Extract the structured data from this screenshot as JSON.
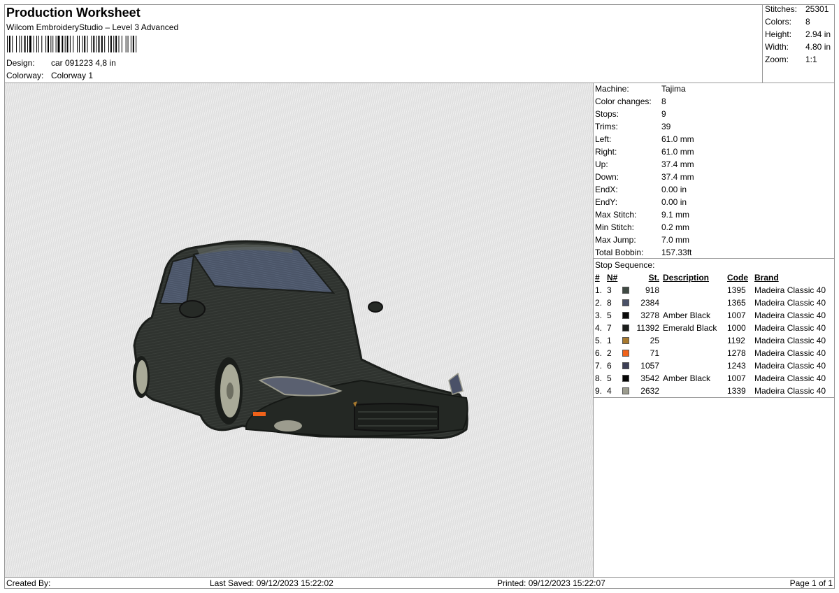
{
  "header": {
    "title": "Production Worksheet",
    "subtitle": "Wilcom EmbroideryStudio – Level 3 Advanced",
    "design_label": "Design:",
    "design_value": "car 091223 4,8 in",
    "colorway_label": "Colorway:",
    "colorway_value": "Colorway 1"
  },
  "summary": [
    {
      "label": "Stitches:",
      "value": "25301"
    },
    {
      "label": "Colors:",
      "value": "8"
    },
    {
      "label": "Height:",
      "value": "2.94 in"
    },
    {
      "label": "Width:",
      "value": "4.80 in"
    },
    {
      "label": "Zoom:",
      "value": "1:1"
    }
  ],
  "machine_info": [
    {
      "label": "Machine:",
      "value": "Tajima"
    },
    {
      "label": "Color changes:",
      "value": "8"
    },
    {
      "label": "Stops:",
      "value": "9"
    },
    {
      "label": "Trims:",
      "value": "39"
    },
    {
      "label": "Left:",
      "value": "61.0 mm"
    },
    {
      "label": "Right:",
      "value": "61.0 mm"
    },
    {
      "label": "Up:",
      "value": "37.4 mm"
    },
    {
      "label": "Down:",
      "value": "37.4 mm"
    },
    {
      "label": "EndX:",
      "value": "0.00 in"
    },
    {
      "label": "EndY:",
      "value": "0.00 in"
    },
    {
      "label": "Max Stitch:",
      "value": "9.1 mm"
    },
    {
      "label": "Min Stitch:",
      "value": "0.2 mm"
    },
    {
      "label": "Max Jump:",
      "value": "7.0 mm"
    },
    {
      "label": "Total Bobbin:",
      "value": "157.33ft"
    }
  ],
  "stop_sequence": {
    "title": "Stop Sequence:",
    "headers": {
      "idx": "#",
      "needle": "N#",
      "stitches": "St.",
      "description": "Description",
      "code": "Code",
      "brand": "Brand"
    },
    "rows": [
      {
        "idx": "1.",
        "needle": "3",
        "color": "#3f4a43",
        "stitches": "918",
        "description": "",
        "code": "1395",
        "brand": "Madeira Classic 40"
      },
      {
        "idx": "2.",
        "needle": "8",
        "color": "#4a5168",
        "stitches": "2384",
        "description": "",
        "code": "1365",
        "brand": "Madeira Classic 40"
      },
      {
        "idx": "3.",
        "needle": "5",
        "color": "#0a0a0a",
        "stitches": "3278",
        "description": "Amber Black",
        "code": "1007",
        "brand": "Madeira Classic 40"
      },
      {
        "idx": "4.",
        "needle": "7",
        "color": "#1a1d1b",
        "stitches": "11392",
        "description": "Emerald Black",
        "code": "1000",
        "brand": "Madeira Classic 40"
      },
      {
        "idx": "5.",
        "needle": "1",
        "color": "#a8792e",
        "stitches": "25",
        "description": "",
        "code": "1192",
        "brand": "Madeira Classic 40"
      },
      {
        "idx": "6.",
        "needle": "2",
        "color": "#f0621a",
        "stitches": "71",
        "description": "",
        "code": "1278",
        "brand": "Madeira Classic 40"
      },
      {
        "idx": "7.",
        "needle": "6",
        "color": "#3c3f55",
        "stitches": "1057",
        "description": "",
        "code": "1243",
        "brand": "Madeira Classic 40"
      },
      {
        "idx": "8.",
        "needle": "5",
        "color": "#050505",
        "stitches": "3542",
        "description": "Amber Black",
        "code": "1007",
        "brand": "Madeira Classic 40"
      },
      {
        "idx": "9.",
        "needle": "4",
        "color": "#9c9c8e",
        "stitches": "2632",
        "description": "",
        "code": "1339",
        "brand": "Madeira Classic 40"
      }
    ]
  },
  "footer": {
    "created_by": "Created By:",
    "last_saved": "Last Saved: 09/12/2023 15:22:02",
    "printed": "Printed: 09/12/2023 15:22:07",
    "page": "Page 1 of 1"
  },
  "design_image": {
    "icon": "car-embroidery-preview"
  }
}
